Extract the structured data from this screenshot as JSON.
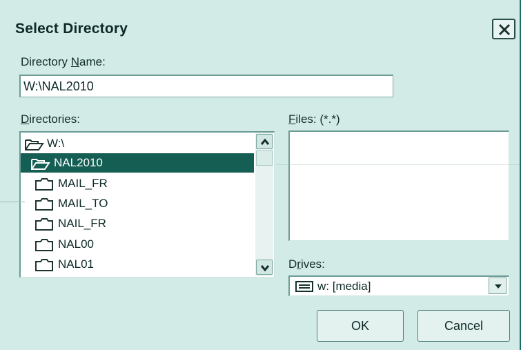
{
  "window": {
    "title": "Select Directory"
  },
  "directory_name": {
    "label_pre": "Directory ",
    "label_key": "N",
    "label_post": "ame:",
    "value": "W:\\NAL2010"
  },
  "directories": {
    "label_key": "D",
    "label_post": "irectories:",
    "items": [
      {
        "name": "W:\\",
        "icon": "open-folder-icon",
        "selected": false
      },
      {
        "name": "NAL2010",
        "icon": "open-folder-icon",
        "selected": true
      },
      {
        "name": "MAIL_FR",
        "icon": "folder-icon",
        "selected": false
      },
      {
        "name": "MAIL_TO",
        "icon": "folder-icon",
        "selected": false
      },
      {
        "name": "NAIL_FR",
        "icon": "folder-icon",
        "selected": false
      },
      {
        "name": "NAL00",
        "icon": "folder-icon",
        "selected": false
      },
      {
        "name": "NAL01",
        "icon": "folder-icon",
        "selected": false
      }
    ]
  },
  "files": {
    "label_key": "F",
    "label_post": "iles: (*.*)"
  },
  "drives": {
    "label_pre": "D",
    "label_key": "r",
    "label_post": "ives:",
    "selected": "w: [media]",
    "icon": "drive-icon"
  },
  "buttons": {
    "ok": "OK",
    "cancel": "Cancel"
  },
  "colors": {
    "dialog_bg": "#d3ebe6",
    "selection_bg": "#155e53",
    "border": "#1c6e62"
  }
}
